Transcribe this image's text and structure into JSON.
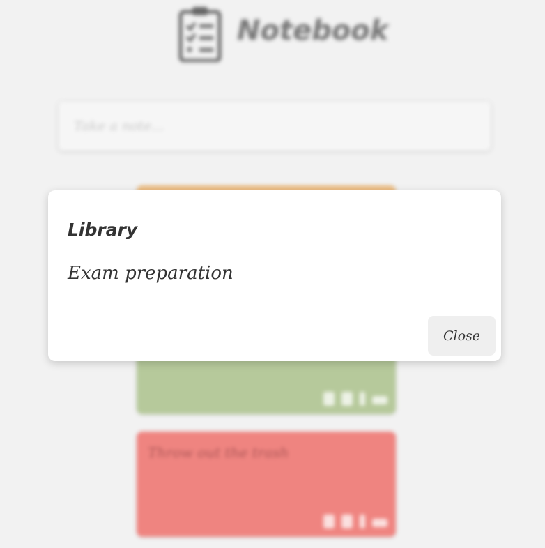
{
  "app": {
    "title": "Notebook",
    "logo_icon": "clipboard-checklist-icon"
  },
  "note_input": {
    "placeholder": "Take a note..."
  },
  "notes": [
    {
      "text": "",
      "color": "#edbd82"
    },
    {
      "text": "",
      "color": "#b6c99b"
    },
    {
      "text": "Throw out the trash",
      "color": "#ef8480"
    }
  ],
  "card_action_icons": [
    "trash-icon",
    "palette-icon",
    "priority-icon",
    "check-icon"
  ],
  "modal": {
    "title": "Library",
    "body": "Exam preparation",
    "close_label": "Close"
  }
}
